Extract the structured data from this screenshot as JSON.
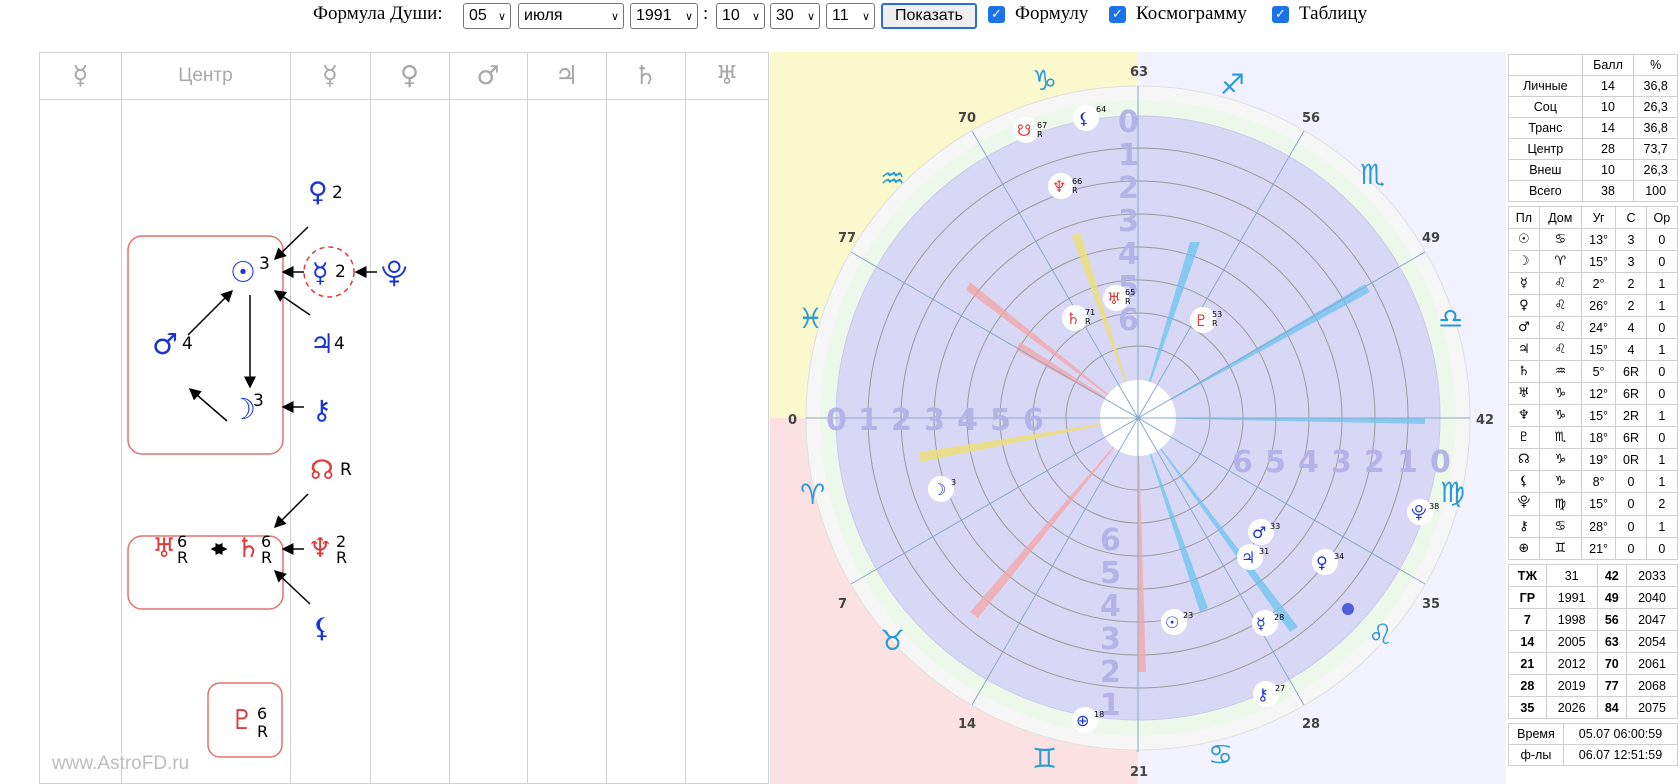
{
  "toolbar": {
    "formula_label": "Формула Души:",
    "day": "05",
    "month": "июля",
    "year": "1991",
    "colon": ":",
    "hour": "10",
    "minute": "30",
    "second": "11",
    "show_button": "Показать",
    "cb_formula": "Формулу",
    "cb_cosmogram": "Космограмму",
    "cb_table": "Таблицу"
  },
  "formula": {
    "headers": [
      "☿",
      "Центр",
      "☿",
      "♀",
      "♂",
      "♃",
      "♄",
      "♅"
    ],
    "watermark": "www.AstroFD.ru",
    "labels": {
      "venus_top": "2",
      "sun": "3",
      "mercury": "2",
      "mars": "4",
      "jupiter": "4",
      "moon": "3",
      "node": "R",
      "uranus_n": "6",
      "uranus_r": "R",
      "saturn_n": "6",
      "saturn_r": "R",
      "neptune_n": "2",
      "neptune_r": "R",
      "pluto_n": "6",
      "pluto_r": "R"
    }
  },
  "cosmogram": {
    "degree_labels": [
      "63",
      "56",
      "49",
      "42",
      "35",
      "28",
      "21",
      "14",
      "7",
      "0",
      "77",
      "70"
    ],
    "rings": [
      "0",
      "1",
      "2",
      "3",
      "4",
      "5",
      "6"
    ],
    "planets": [
      {
        "glyph": "☋",
        "n": "67",
        "r": "R"
      },
      {
        "glyph": "⚸",
        "n": "64",
        "r": ""
      },
      {
        "glyph": "♆",
        "n": "66",
        "r": "R"
      },
      {
        "glyph": "♄",
        "n": "71",
        "r": "R"
      },
      {
        "glyph": "♅",
        "n": "65",
        "r": "R"
      },
      {
        "glyph": "♇",
        "n": "53",
        "r": "R"
      },
      {
        "glyph": "☽",
        "n": "3",
        "r": ""
      },
      {
        "glyph": "⯓",
        "n": "38",
        "r": ""
      },
      {
        "glyph": "♂",
        "n": "33",
        "r": ""
      },
      {
        "glyph": "♃",
        "n": "31",
        "r": ""
      },
      {
        "glyph": "♀",
        "n": "34",
        "r": ""
      },
      {
        "glyph": "☉",
        "n": "23",
        "r": ""
      },
      {
        "glyph": "☿",
        "n": "28",
        "r": ""
      },
      {
        "glyph": "⚷",
        "n": "27",
        "r": ""
      },
      {
        "glyph": "⊕",
        "n": "18",
        "r": ""
      }
    ]
  },
  "scores": {
    "headers": [
      "",
      "Балл",
      "%"
    ],
    "rows": [
      [
        "Личные",
        "14",
        "36,8"
      ],
      [
        "Соц",
        "10",
        "26,3"
      ],
      [
        "Транс",
        "14",
        "36,8"
      ],
      [
        "Центр",
        "28",
        "73,7"
      ],
      [
        "Внеш",
        "10",
        "26,3"
      ],
      [
        "Всего",
        "38",
        "100"
      ]
    ]
  },
  "planets_table": {
    "headers": [
      "Пл",
      "Дом",
      "Уг",
      "С",
      "Ор"
    ],
    "rows": [
      [
        "☉",
        "♋",
        "13°",
        "3",
        "0"
      ],
      [
        "☽",
        "♈",
        "15°",
        "3",
        "0"
      ],
      [
        "☿",
        "♌",
        "2°",
        "2",
        "1"
      ],
      [
        "♀",
        "♌",
        "26°",
        "2",
        "1"
      ],
      [
        "♂",
        "♌",
        "24°",
        "4",
        "0"
      ],
      [
        "♃",
        "♌",
        "15°",
        "4",
        "1"
      ],
      [
        "♄",
        "♒",
        "5°",
        "6R",
        "0"
      ],
      [
        "♅",
        "♑",
        "12°",
        "6R",
        "0"
      ],
      [
        "♆",
        "♑",
        "15°",
        "2R",
        "1"
      ],
      [
        "♇",
        "♏",
        "18°",
        "6R",
        "0"
      ],
      [
        "☊",
        "♑",
        "19°",
        "0R",
        "1"
      ],
      [
        "⚸",
        "♑",
        "8°",
        "0",
        "1"
      ],
      [
        "⯓",
        "♍",
        "15°",
        "0",
        "2"
      ],
      [
        "⚷",
        "♋",
        "28°",
        "0",
        "1"
      ],
      [
        "⊕",
        "♊",
        "21°",
        "0",
        "0"
      ]
    ]
  },
  "years_table": {
    "rows": [
      [
        "ТЖ",
        "31",
        "42",
        "2033"
      ],
      [
        "ГР",
        "1991",
        "49",
        "2040"
      ],
      [
        "7",
        "1998",
        "56",
        "2047"
      ],
      [
        "14",
        "2005",
        "63",
        "2054"
      ],
      [
        "21",
        "2012",
        "70",
        "2061"
      ],
      [
        "28",
        "2019",
        "77",
        "2068"
      ],
      [
        "35",
        "2026",
        "84",
        "2075"
      ]
    ]
  },
  "time_table": {
    "rows": [
      [
        "Время",
        "05.07 06:00:59"
      ],
      [
        "ф-лы",
        "06.07 12:51:59"
      ]
    ]
  },
  "colors": {
    "blue": "#1a33d6",
    "red": "#e03a3a",
    "grid": "#d0d0d0"
  }
}
